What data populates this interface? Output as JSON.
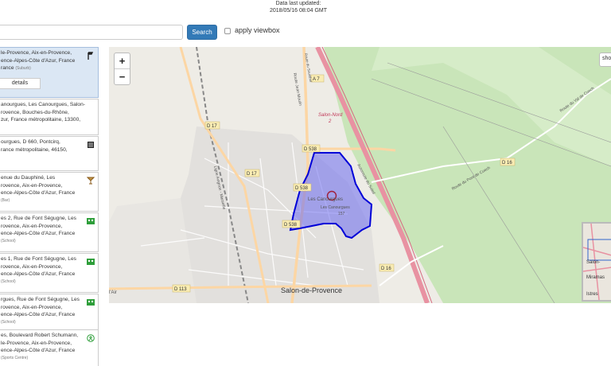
{
  "header": {
    "updated_label": "Data last updated:",
    "updated_time": "2018/05/16 08:04 GMT"
  },
  "search": {
    "input_value": "",
    "button_label": "Search",
    "viewbox_label": "apply viewbox",
    "viewbox_checked": false
  },
  "results": [
    {
      "lines": [
        "le-Provence, Aix-en-Provence,",
        "ence-Alpes-Côte d'Azur, France"
      ],
      "tail": "rance",
      "type": "(Suburb)",
      "icon": "flag-icon",
      "details_label": "details",
      "selected": true
    },
    {
      "lines": [
        "anourgues, Les Canourgues, Salon-",
        "rovence, Bouches-du-Rhône,",
        "zur, France métropolitaine, 13300,"
      ],
      "tail": "",
      "type": "",
      "icon": "",
      "selected": false
    },
    {
      "lines": [
        "ourgues, D 660, Pontcirq,",
        "rance métropolitaine, 46150,"
      ],
      "tail": "",
      "type": "",
      "icon": "square-icon",
      "selected": false
    },
    {
      "lines": [
        "enue du Dauphiné, Les",
        "rovence, Aix-en-Provence,",
        "ence-Alpes-Côte d'Azur, France"
      ],
      "tail": "",
      "type": "(Bar)",
      "icon": "cocktail-icon",
      "selected": false
    },
    {
      "lines": [
        "es 2, Rue de Font Ségugne, Les",
        "rovence, Aix-en-Provence,",
        "ence-Alpes-Côte d'Azur, France"
      ],
      "tail": "",
      "type": "(School)",
      "icon": "school-icon",
      "selected": false
    },
    {
      "lines": [
        "es 1, Rue de Font Ségugne, Les",
        "rovence, Aix-en-Provence,",
        "ence-Alpes-Côte d'Azur, France"
      ],
      "tail": "",
      "type": "(School)",
      "icon": "school-icon",
      "selected": false
    },
    {
      "lines": [
        "rgues, Rue de Font Ségugne, Les",
        "rovence, Aix-en-Provence,",
        "ence-Alpes-Côte d'Azur, France"
      ],
      "tail": "",
      "type": "(School)",
      "icon": "school-icon",
      "selected": false
    },
    {
      "lines": [
        "es, Boulevard Robert Schumann,",
        "le-Provence, Aix-en-Provence,",
        "ence-Alpes-Côte d'Azur, France"
      ],
      "tail": "",
      "type": "(Sports Centre)",
      "icon": "sports-icon",
      "selected": false
    }
  ],
  "map": {
    "zoom_in": "+",
    "zoom_out": "−",
    "show_label": "show",
    "labels": {
      "town": "Salon-de-Provence",
      "district": "Les Canourgues",
      "district_sub": "Les Canourgues",
      "district_sub2": "157",
      "salon_nord": "Salon-Nord",
      "salon_nord_num": "2",
      "air": "l'Air",
      "roads": [
        "A 7",
        "D 17",
        "D 538",
        "D 538",
        "D 17",
        "D 538",
        "D 16",
        "D 16",
        "D 113"
      ],
      "street_jean_moulin": "Route Jean Moulin",
      "street_val_cuech": "Route du Val de Cuech",
      "street_pont_de_cuech": "Route du Pont de Cuech",
      "autoroute": "Autoroute du Soleil",
      "rail": "Ligne Avignon - Marseille",
      "cadastre": "Route du Sousthol"
    },
    "minimap_labels": [
      "Salon-",
      "Miramas",
      "Istres"
    ],
    "colors": {
      "water_green": "#c6e3b5",
      "park": "#d8eecb",
      "urban": "#e0dfdf",
      "polygon_fill": "#6c6cf0",
      "polygon_stroke": "#0000d8",
      "motorway": "#e892a2",
      "primary": "#fcd6a4"
    }
  }
}
